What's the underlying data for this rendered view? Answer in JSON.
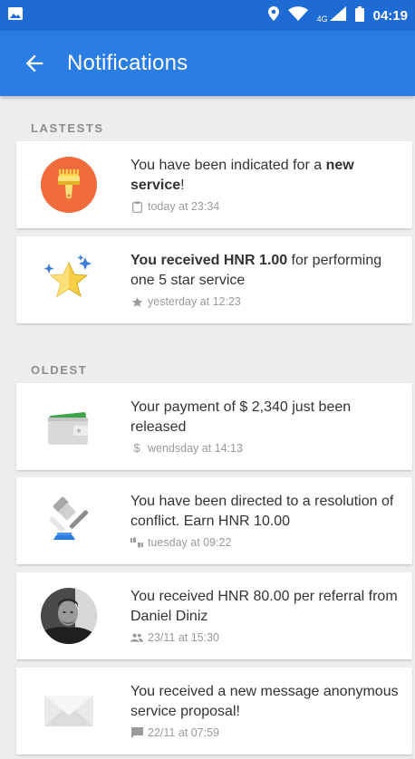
{
  "status_bar": {
    "time": "04:19",
    "network": "4G",
    "icons": [
      "image-icon",
      "location-icon",
      "wifi-icon",
      "signal-icon",
      "battery-icon"
    ]
  },
  "app_bar": {
    "title": "Notifications",
    "back_icon": "arrow-back-icon"
  },
  "colors": {
    "status_bar": "#1e6bd6",
    "app_bar": "#2a7de2",
    "background": "#eeeeee",
    "card": "#ffffff"
  },
  "sections": [
    {
      "title": "LASTESTS",
      "items": [
        {
          "icon": "paint-brush-icon",
          "text_plain": "You have been indicated for a ",
          "text_bold": "new service",
          "text_after": "!",
          "meta_icon": "clipboard-icon",
          "meta": "today at 23:34"
        },
        {
          "icon": "star-icon",
          "text_bold": "You received HNR 1.00",
          "text_after": " for performing one 5 star service",
          "meta_icon": "star-small-icon",
          "meta": "yesterday at 12:23"
        }
      ]
    },
    {
      "title": "OLDEST",
      "items": [
        {
          "icon": "wallet-icon",
          "text": "Your payment of $ 2,340 just been released",
          "meta_icon": "dollar-icon",
          "meta": "wendsday at 14:13"
        },
        {
          "icon": "gavel-icon",
          "text": "You have been directed to a resolution of conflict. Earn HNR 10.00",
          "meta_icon": "thumbs-icon",
          "meta": "tuesday at 09:22"
        },
        {
          "icon": "avatar-photo",
          "text": "You received HNR 80.00 per referral from Daniel Diniz",
          "meta_icon": "people-icon",
          "meta": "23/11 at 15:30"
        },
        {
          "icon": "envelope-icon",
          "text": "You received a new message anonymous service proposal!",
          "meta_icon": "chat-icon",
          "meta": "22/11 at 07:59"
        }
      ]
    }
  ]
}
